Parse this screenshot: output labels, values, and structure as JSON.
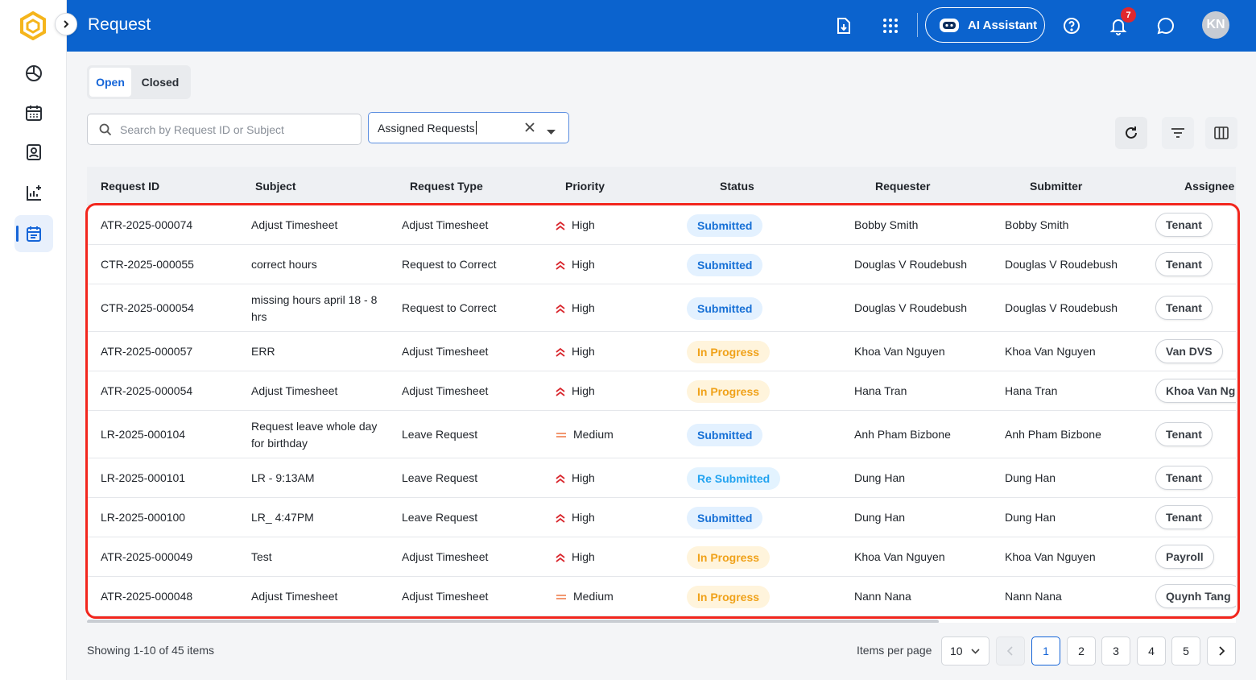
{
  "header": {
    "title": "Request",
    "ai_label": "AI Assistant",
    "notif_count": "7",
    "avatar_initials": "KN"
  },
  "tabs": [
    {
      "label": "Open"
    },
    {
      "label": "Closed"
    }
  ],
  "search": {
    "placeholder": "Search by Request ID or Subject",
    "value": ""
  },
  "filter": {
    "value": "Assigned Requests"
  },
  "table": {
    "columns": [
      "Request ID",
      "Subject",
      "Request Type",
      "Priority",
      "Status",
      "Requester",
      "Submitter",
      "Assignee"
    ],
    "rows": [
      {
        "id": "ATR-2025-000074",
        "subject": "Adjust Timesheet",
        "type": "Adjust Timesheet",
        "priority": "High",
        "status": "Submitted",
        "requester": "Bobby Smith",
        "submitter": "Bobby Smith",
        "assignee": "Tenant"
      },
      {
        "id": "CTR-2025-000055",
        "subject": "correct hours",
        "type": "Request to Correct",
        "priority": "High",
        "status": "Submitted",
        "requester": "Douglas V Roudebush",
        "submitter": "Douglas V Roudebush",
        "assignee": "Tenant"
      },
      {
        "id": "CTR-2025-000054",
        "subject": "missing hours april 18 - 8 hrs",
        "type": "Request to Correct",
        "priority": "High",
        "status": "Submitted",
        "requester": "Douglas V Roudebush",
        "submitter": "Douglas V Roudebush",
        "assignee": "Tenant"
      },
      {
        "id": "ATR-2025-000057",
        "subject": "ERR",
        "type": "Adjust Timesheet",
        "priority": "High",
        "status": "In Progress",
        "requester": "Khoa Van Nguyen",
        "submitter": "Khoa Van Nguyen",
        "assignee": "Van DVS"
      },
      {
        "id": "ATR-2025-000054",
        "subject": "Adjust Timesheet",
        "type": "Adjust Timesheet",
        "priority": "High",
        "status": "In Progress",
        "requester": "Hana Tran",
        "submitter": "Hana Tran",
        "assignee": "Khoa Van Nguyen"
      },
      {
        "id": "LR-2025-000104",
        "subject": "Request leave whole day for birthday",
        "type": "Leave Request",
        "priority": "Medium",
        "status": "Submitted",
        "requester": "Anh Pham Bizbone",
        "submitter": "Anh Pham Bizbone",
        "assignee": "Tenant"
      },
      {
        "id": "LR-2025-000101",
        "subject": "LR - 9:13AM",
        "type": "Leave Request",
        "priority": "High",
        "status": "Re Submitted",
        "requester": "Dung Han",
        "submitter": "Dung Han",
        "assignee": "Tenant"
      },
      {
        "id": "LR-2025-000100",
        "subject": "LR_ 4:47PM",
        "type": "Leave Request",
        "priority": "High",
        "status": "Submitted",
        "requester": "Dung Han",
        "submitter": "Dung Han",
        "assignee": "Tenant"
      },
      {
        "id": "ATR-2025-000049",
        "subject": "Test",
        "type": "Adjust Timesheet",
        "priority": "High",
        "status": "In Progress",
        "requester": "Khoa Van Nguyen",
        "submitter": "Khoa Van Nguyen",
        "assignee": "Payroll"
      },
      {
        "id": "ATR-2025-000048",
        "subject": "Adjust Timesheet",
        "type": "Adjust Timesheet",
        "priority": "Medium",
        "status": "In Progress",
        "requester": "Nann Nana",
        "submitter": "Nann Nana",
        "assignee": "Quynh Tang"
      }
    ]
  },
  "footer": {
    "showing": "Showing 1-10 of 45 items",
    "items_per_page_label": "Items per page",
    "items_per_page": "10",
    "pages": [
      "1",
      "2",
      "3",
      "4",
      "5"
    ],
    "current_page": "1"
  },
  "colors": {
    "header": "#0b63ce",
    "accent": "#1565d8",
    "high_priority": "#d9262d",
    "medium_priority": "#f08a5d",
    "highlight_border": "#f2261d"
  }
}
